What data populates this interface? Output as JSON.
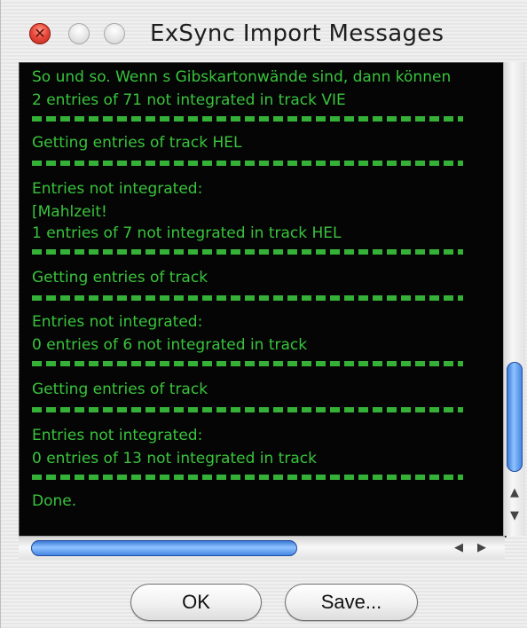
{
  "window": {
    "title": "ExSync Import Messages"
  },
  "log": {
    "lines": [
      "So und so. Wenn s Gibskartonwände sind, dann können",
      "2 entries of 71 not integrated in track VIE",
      "Getting entries of track HEL",
      "Entries not integrated:",
      "[Mahlzeit!",
      "1 entries of 7 not integrated in track HEL",
      "Getting entries of track",
      "Entries not integrated:",
      "0 entries of 6 not integrated in track",
      "Getting entries of track",
      "Entries not integrated:",
      "0 entries of 13 not integrated in track",
      "Done."
    ]
  },
  "scrollbars": {
    "vertical_position": 0.75,
    "horizontal_position": 0.0
  },
  "buttons": {
    "ok": "OK",
    "save": "Save..."
  },
  "colors": {
    "console_background": "#050505",
    "console_text": "#39c43c",
    "scroll_thumb": "#3d7fe0"
  }
}
